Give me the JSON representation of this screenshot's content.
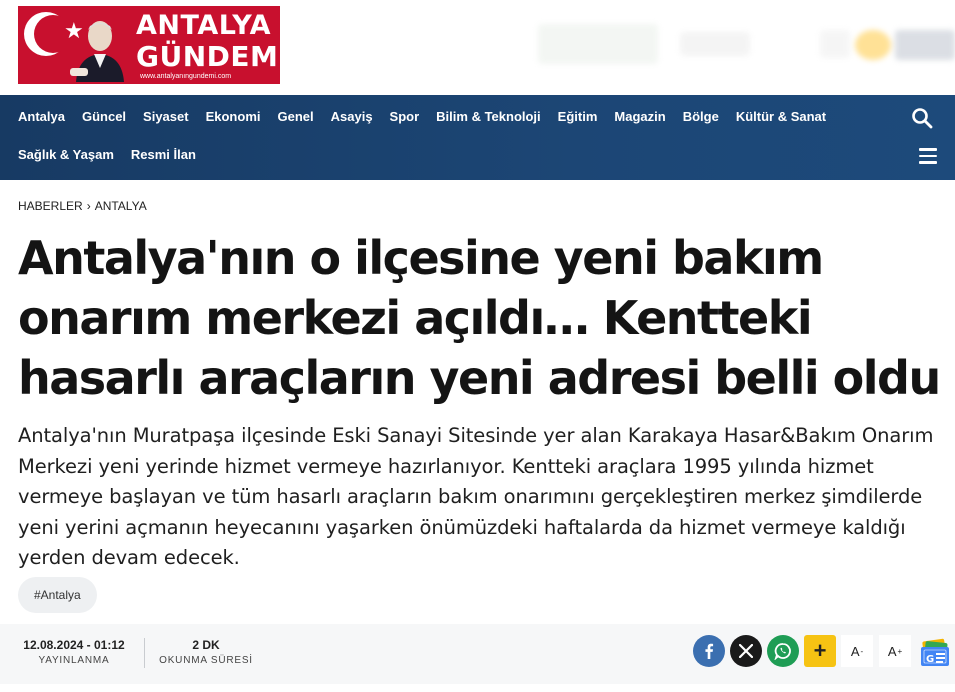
{
  "header": {
    "logo_line1": "ANTALYA",
    "logo_line2": "GÜNDEM",
    "logo_url": "www.antalyanıngundemi.com",
    "brand_red": "#c8102e"
  },
  "nav": {
    "items_row1": [
      "Antalya",
      "Güncel",
      "Siyaset",
      "Ekonomi",
      "Genel",
      "Asayiş",
      "Spor",
      "Bilim & Teknoloji",
      "Eğitim",
      "Magazin",
      "Bölge",
      "Kültür & Sanat"
    ],
    "items_row2": [
      "Sağlık & Yaşam",
      "Resmi İlan"
    ],
    "search_icon": "search-icon",
    "menu_icon": "hamburger-menu-icon",
    "bg_color": "#1c4675"
  },
  "breadcrumb": {
    "home": "HABERLER",
    "current": "ANTALYA"
  },
  "article": {
    "title": "Antalya'nın o ilçesine yeni bakım onarım merkezi açıldı… Kentteki hasarlı araçların yeni adresi belli oldu",
    "summary": "Antalya'nın Muratpaşa ilçesinde Eski Sanayi Sitesinde yer alan Karakaya Hasar&Bakım Onarım Merkezi yeni yerinde hizmet vermeye hazırlanıyor. Kentteki araçlara 1995 yılında hizmet vermeye başlayan ve tüm hasarlı araçların bakım onarımını gerçekleştiren merkez şimdilerde yeni yerini açmanın heyecanını yaşarken önümüzdeki haftalarda da hizmet vermeye kaldığı yerden devam edecek.",
    "tag": "#Antalya"
  },
  "meta": {
    "date_value": "12.08.2024 - 01:12",
    "date_label": "YAYINLANMA",
    "read_value": "2 DK",
    "read_label": "OKUNMA SÜRESİ"
  },
  "share": {
    "icons": [
      "facebook-icon",
      "x-icon",
      "whatsapp-icon",
      "plus-icon",
      "font-decrease-icon",
      "font-increase-icon",
      "google-news-icon"
    ],
    "font_small": "A",
    "font_small_sup": "-",
    "font_large": "A",
    "font_large_sup": "+",
    "plus": "+",
    "colors": {
      "facebook": "#3b6fb0",
      "x": "#1a1a1a",
      "whatsapp": "#1f9d55",
      "plus": "#f6c313"
    }
  }
}
